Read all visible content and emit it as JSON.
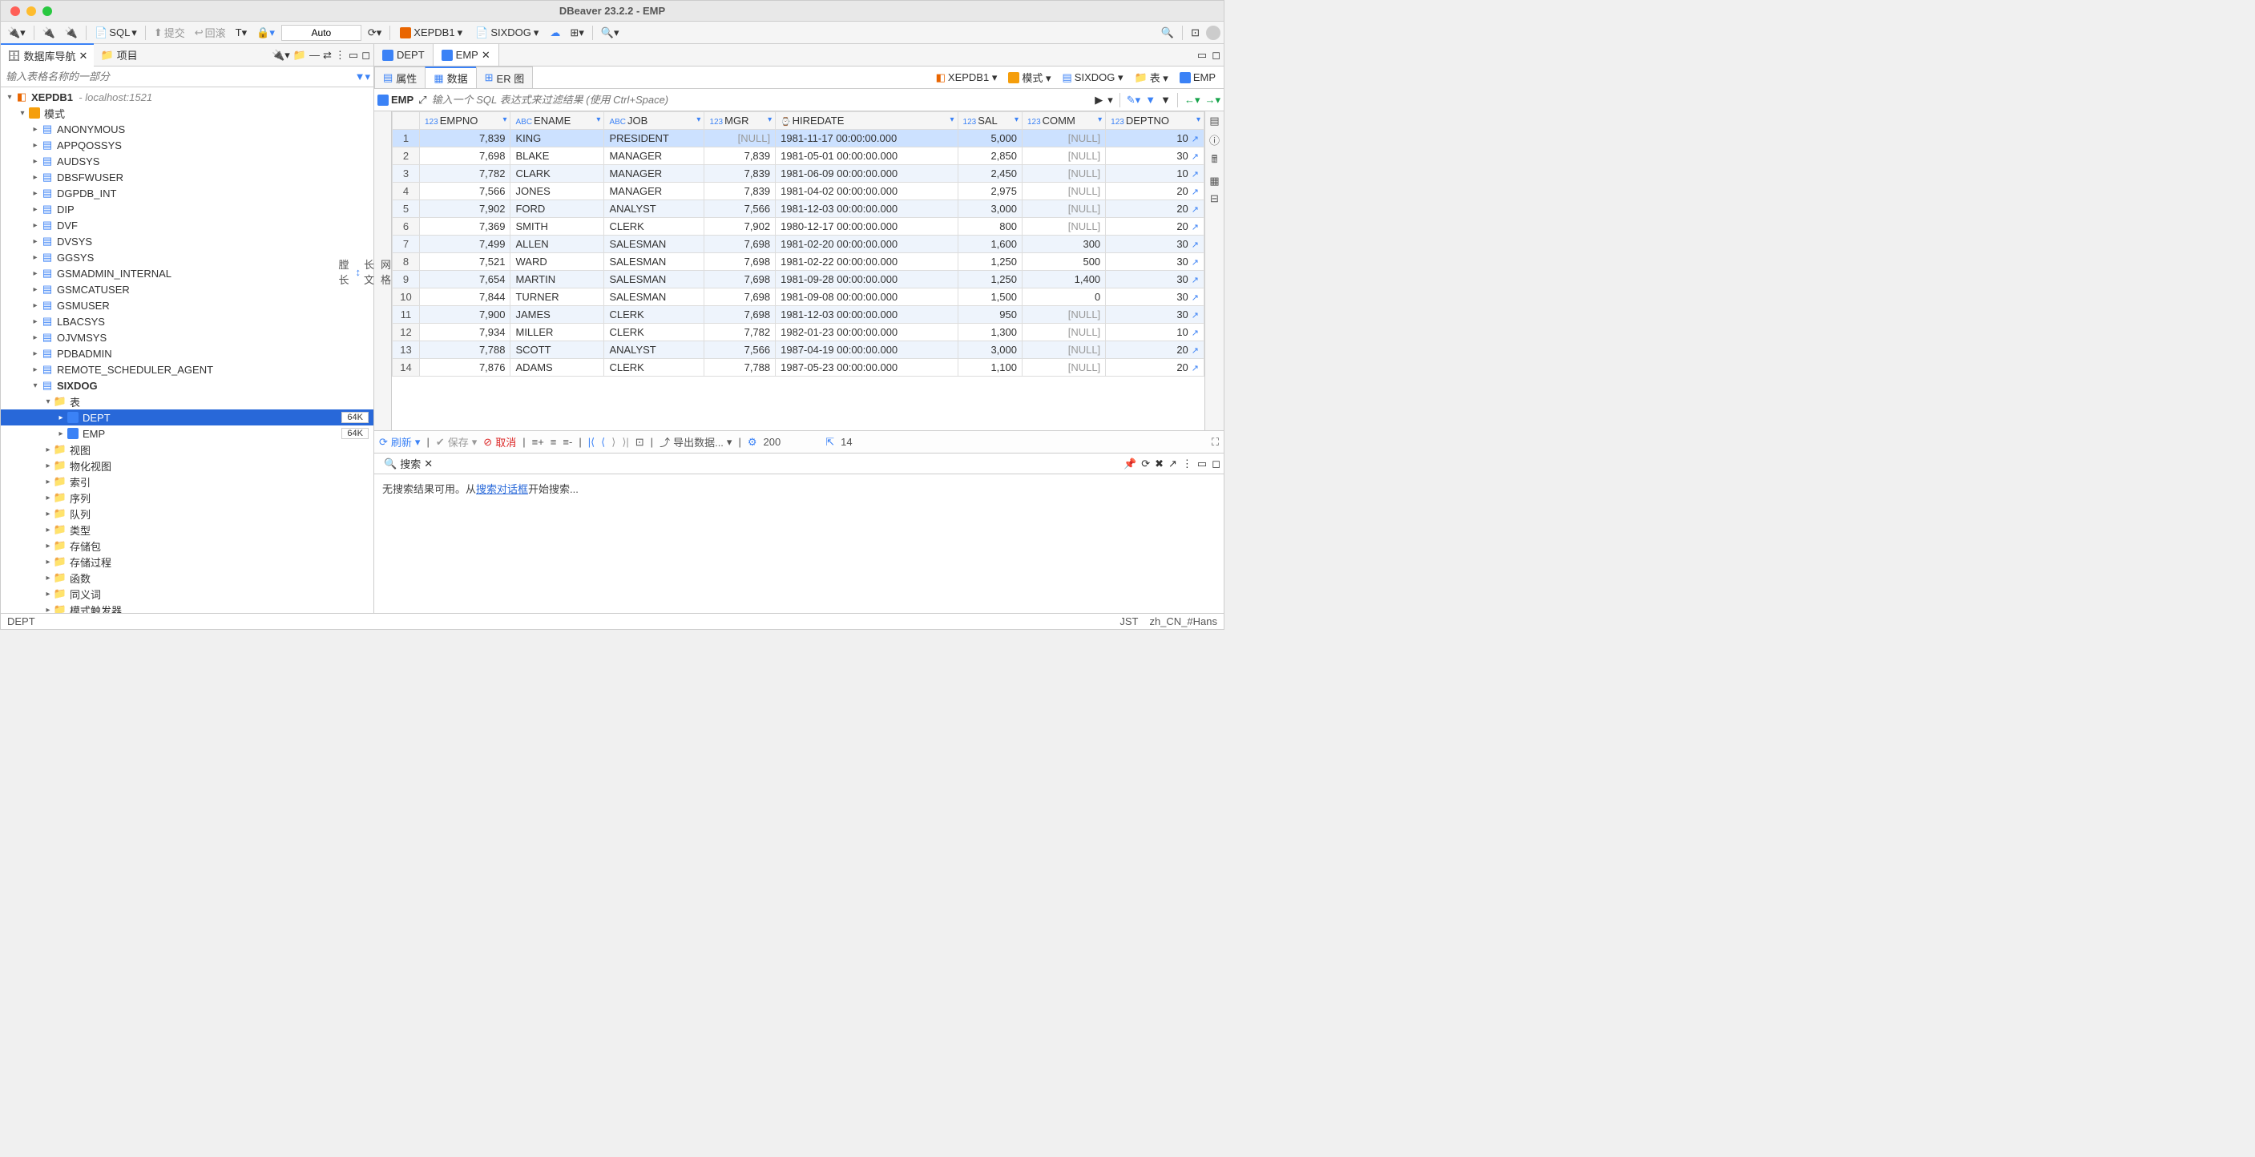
{
  "title": "DBeaver 23.2.2 - EMP",
  "toolbar": {
    "sql_label": "SQL",
    "commit_label": "提交",
    "rollback_label": "回滚",
    "auto_label": "Auto",
    "conn_label": "XEPDB1",
    "schema_label": "SIXDOG"
  },
  "left": {
    "tabs": {
      "nav": "数据库导航",
      "project": "项目"
    },
    "filter_placeholder": "输入表格名称的一部分",
    "root": {
      "label": "XEPDB1",
      "host": "- localhost:1521"
    },
    "schema_label": "模式",
    "schemas": [
      "ANONYMOUS",
      "APPQOSSYS",
      "AUDSYS",
      "DBSFWUSER",
      "DGPDB_INT",
      "DIP",
      "DVF",
      "DVSYS",
      "GGSYS",
      "GSMADMIN_INTERNAL",
      "GSMCATUSER",
      "GSMUSER",
      "LBACSYS",
      "OJVMSYS",
      "PDBADMIN",
      "REMOTE_SCHEDULER_AGENT"
    ],
    "current_schema": "SIXDOG",
    "tables_label": "表",
    "tables": [
      {
        "name": "DEPT",
        "size": "64K",
        "selected": true
      },
      {
        "name": "EMP",
        "size": "64K",
        "selected": false
      }
    ],
    "folders": [
      "视图",
      "物化视图",
      "索引",
      "序列",
      "队列",
      "类型",
      "存储包",
      "存储过程",
      "函数",
      "同义词",
      "模式触发器"
    ]
  },
  "editor": {
    "tabs": [
      {
        "label": "DEPT",
        "active": false,
        "closable": false
      },
      {
        "label": "EMP",
        "active": true,
        "closable": true
      }
    ],
    "sub_tabs": [
      {
        "label": "属性",
        "active": false
      },
      {
        "label": "数据",
        "active": true
      },
      {
        "label": "ER 图",
        "active": false
      }
    ],
    "breadcrumb": [
      "XEPDB1",
      "模式",
      "SIXDOG",
      "表",
      "EMP"
    ],
    "sql_chip": "EMP",
    "sql_placeholder": "输入一个 SQL 表达式来过滤结果 (使用 Ctrl+Space)"
  },
  "grid": {
    "gutter": {
      "top": "网格",
      "mid": "长文",
      "bot": "膛长"
    },
    "columns": [
      {
        "name": "EMPNO",
        "type": "123"
      },
      {
        "name": "ENAME",
        "type": "ABC"
      },
      {
        "name": "JOB",
        "type": "ABC"
      },
      {
        "name": "MGR",
        "type": "123"
      },
      {
        "name": "HIREDATE",
        "type": "⌚"
      },
      {
        "name": "SAL",
        "type": "123"
      },
      {
        "name": "COMM",
        "type": "123"
      },
      {
        "name": "DEPTNO",
        "type": "123"
      }
    ],
    "rows": [
      {
        "n": 1,
        "EMPNO": "7,839",
        "ENAME": "KING",
        "JOB": "PRESIDENT",
        "MGR": "[NULL]",
        "HIREDATE": "1981-11-17 00:00:00.000",
        "SAL": "5,000",
        "COMM": "[NULL]",
        "DEPTNO": "10"
      },
      {
        "n": 2,
        "EMPNO": "7,698",
        "ENAME": "BLAKE",
        "JOB": "MANAGER",
        "MGR": "7,839",
        "HIREDATE": "1981-05-01 00:00:00.000",
        "SAL": "2,850",
        "COMM": "[NULL]",
        "DEPTNO": "30"
      },
      {
        "n": 3,
        "EMPNO": "7,782",
        "ENAME": "CLARK",
        "JOB": "MANAGER",
        "MGR": "7,839",
        "HIREDATE": "1981-06-09 00:00:00.000",
        "SAL": "2,450",
        "COMM": "[NULL]",
        "DEPTNO": "10"
      },
      {
        "n": 4,
        "EMPNO": "7,566",
        "ENAME": "JONES",
        "JOB": "MANAGER",
        "MGR": "7,839",
        "HIREDATE": "1981-04-02 00:00:00.000",
        "SAL": "2,975",
        "COMM": "[NULL]",
        "DEPTNO": "20"
      },
      {
        "n": 5,
        "EMPNO": "7,902",
        "ENAME": "FORD",
        "JOB": "ANALYST",
        "MGR": "7,566",
        "HIREDATE": "1981-12-03 00:00:00.000",
        "SAL": "3,000",
        "COMM": "[NULL]",
        "DEPTNO": "20"
      },
      {
        "n": 6,
        "EMPNO": "7,369",
        "ENAME": "SMITH",
        "JOB": "CLERK",
        "MGR": "7,902",
        "HIREDATE": "1980-12-17 00:00:00.000",
        "SAL": "800",
        "COMM": "[NULL]",
        "DEPTNO": "20"
      },
      {
        "n": 7,
        "EMPNO": "7,499",
        "ENAME": "ALLEN",
        "JOB": "SALESMAN",
        "MGR": "7,698",
        "HIREDATE": "1981-02-20 00:00:00.000",
        "SAL": "1,600",
        "COMM": "300",
        "DEPTNO": "30"
      },
      {
        "n": 8,
        "EMPNO": "7,521",
        "ENAME": "WARD",
        "JOB": "SALESMAN",
        "MGR": "7,698",
        "HIREDATE": "1981-02-22 00:00:00.000",
        "SAL": "1,250",
        "COMM": "500",
        "DEPTNO": "30"
      },
      {
        "n": 9,
        "EMPNO": "7,654",
        "ENAME": "MARTIN",
        "JOB": "SALESMAN",
        "MGR": "7,698",
        "HIREDATE": "1981-09-28 00:00:00.000",
        "SAL": "1,250",
        "COMM": "1,400",
        "DEPTNO": "30"
      },
      {
        "n": 10,
        "EMPNO": "7,844",
        "ENAME": "TURNER",
        "JOB": "SALESMAN",
        "MGR": "7,698",
        "HIREDATE": "1981-09-08 00:00:00.000",
        "SAL": "1,500",
        "COMM": "0",
        "DEPTNO": "30"
      },
      {
        "n": 11,
        "EMPNO": "7,900",
        "ENAME": "JAMES",
        "JOB": "CLERK",
        "MGR": "7,698",
        "HIREDATE": "1981-12-03 00:00:00.000",
        "SAL": "950",
        "COMM": "[NULL]",
        "DEPTNO": "30"
      },
      {
        "n": 12,
        "EMPNO": "7,934",
        "ENAME": "MILLER",
        "JOB": "CLERK",
        "MGR": "7,782",
        "HIREDATE": "1982-01-23 00:00:00.000",
        "SAL": "1,300",
        "COMM": "[NULL]",
        "DEPTNO": "10"
      },
      {
        "n": 13,
        "EMPNO": "7,788",
        "ENAME": "SCOTT",
        "JOB": "ANALYST",
        "MGR": "7,566",
        "HIREDATE": "1987-04-19 00:00:00.000",
        "SAL": "3,000",
        "COMM": "[NULL]",
        "DEPTNO": "20"
      },
      {
        "n": 14,
        "EMPNO": "7,876",
        "ENAME": "ADAMS",
        "JOB": "CLERK",
        "MGR": "7,788",
        "HIREDATE": "1987-05-23 00:00:00.000",
        "SAL": "1,100",
        "COMM": "[NULL]",
        "DEPTNO": "20"
      }
    ],
    "selected_row": 1
  },
  "bottom": {
    "refresh": "刷新",
    "save": "保存",
    "cancel": "取消",
    "export": "导出数据...",
    "page_size": "200",
    "row_count": "14"
  },
  "search": {
    "tab": "搜索",
    "message_pre": "无搜索结果可用。从",
    "link": "搜索对话框",
    "message_post": "开始搜索..."
  },
  "status": {
    "left": "DEPT",
    "tz": "JST",
    "locale": "zh_CN_#Hans"
  }
}
